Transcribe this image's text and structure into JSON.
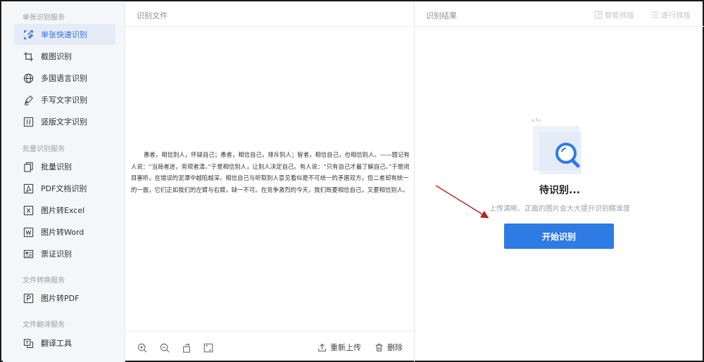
{
  "sidebar": {
    "sections": [
      {
        "title": "单张识别服务"
      },
      {
        "title": "批量识别服务"
      },
      {
        "title": "文件转换服务"
      },
      {
        "title": "文件翻译服务"
      }
    ],
    "items": [
      {
        "label": "单张快速识别",
        "icon": "quick-scan-icon",
        "active": true
      },
      {
        "label": "截图识别",
        "icon": "crop-icon"
      },
      {
        "label": "多国语言识别",
        "icon": "globe-icon"
      },
      {
        "label": "手写文字识别",
        "icon": "pen-icon"
      },
      {
        "label": "竖版文字识别",
        "icon": "vertical-text-icon"
      },
      {
        "label": "批量识别",
        "icon": "batch-icon"
      },
      {
        "label": "PDF文档识别",
        "icon": "pdf-icon"
      },
      {
        "label": "图片转Excel",
        "icon": "excel-icon"
      },
      {
        "label": "图片转Word",
        "icon": "word-icon"
      },
      {
        "label": "票证识别",
        "icon": "ticket-icon"
      },
      {
        "label": "图片转PDF",
        "icon": "image-to-pdf-icon"
      },
      {
        "label": "翻译工具",
        "icon": "translate-icon"
      }
    ]
  },
  "middle": {
    "title": "识别文件",
    "document_text": "愚者，相信别人，怀疑自己；愚者，相信自己，排斥别人；智者，相信自己，也相信别人。——题记有人说：“当局者迷，旁观者清。”于是相信别人，让别人决定自己。有人说：“只有自己才最了解自己。”于是闭目塞听，在错误的泥潭中越陷越深。相信自己与听取别人意见看似是不可统一的矛盾双方，但二者却有统一的一面，它们正如我们的左臂与右臂，缺一不可。在竞争激烈的今天，我们既要相信自己，又要相信别人。",
    "footer": {
      "reupload_label": "重新上传",
      "delete_label": "删除"
    }
  },
  "right": {
    "title": "识别结果",
    "smart_layout_label": "智能排版",
    "line_layout_label": "逐行排版",
    "status": "待识别...",
    "hint": "上传清晰、正面的图片会大大提升识别精准度",
    "start_button": "开始识别"
  },
  "colors": {
    "accent": "#2f7be5",
    "sidebar_bg": "#f5f6f8",
    "active_bg": "#e6ecf7",
    "annotation_arrow": "#b3221b"
  }
}
